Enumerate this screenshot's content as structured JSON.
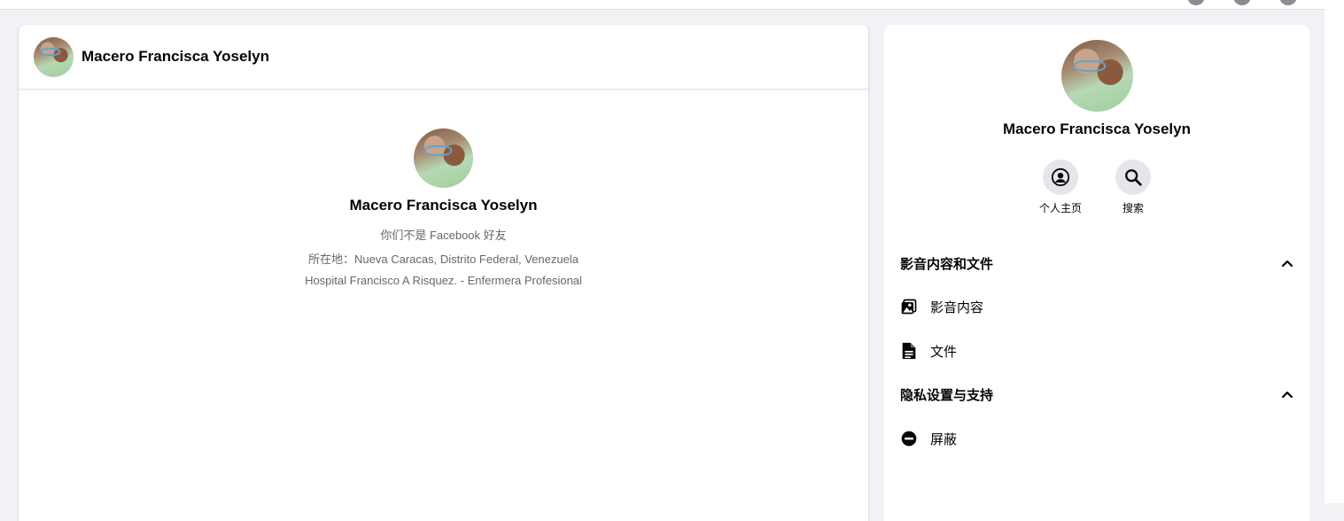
{
  "contact": {
    "name": "Macero Francisca Yoselyn",
    "not_friends": "你们不是 Facebook 好友",
    "location": "所在地：Nueva Caracas, Distrito Federal, Venezuela",
    "work": "Hospital Francisco A Risquez. - Enfermera Profesional"
  },
  "side": {
    "actions": [
      {
        "label": "个人主页",
        "icon": "profile-icon"
      },
      {
        "label": "搜索",
        "icon": "search-icon"
      }
    ],
    "sections": [
      {
        "title": "影音内容和文件",
        "items": [
          {
            "label": "影音内容",
            "icon": "media-icon"
          },
          {
            "label": "文件",
            "icon": "file-icon"
          }
        ]
      },
      {
        "title": "隐私设置与支持",
        "items": [
          {
            "label": "屏蔽",
            "icon": "block-icon"
          }
        ]
      }
    ]
  },
  "colors": {
    "background": "#f0f2f5",
    "panel": "#ffffff",
    "secondary_text": "#65676b",
    "button_bg": "#e4e6eb"
  }
}
